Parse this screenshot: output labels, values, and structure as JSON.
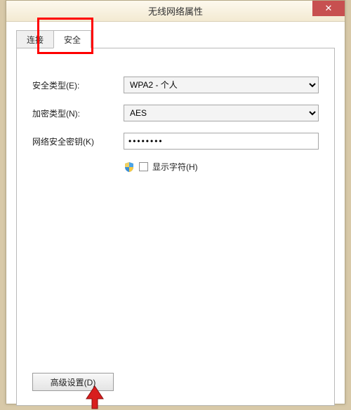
{
  "window": {
    "title": "无线网络属性",
    "close_symbol": "✕"
  },
  "tabs": {
    "connect": "连接",
    "security": "安全"
  },
  "form": {
    "security_type_label": "安全类型(E):",
    "security_type_value": "WPA2 - 个人",
    "encryption_type_label": "加密类型(N):",
    "encryption_type_value": "AES",
    "security_key_label": "网络安全密钥(K)",
    "security_key_value": "••••••••",
    "show_chars_label": "显示字符(H)"
  },
  "buttons": {
    "advanced": "高级设置(D)"
  }
}
